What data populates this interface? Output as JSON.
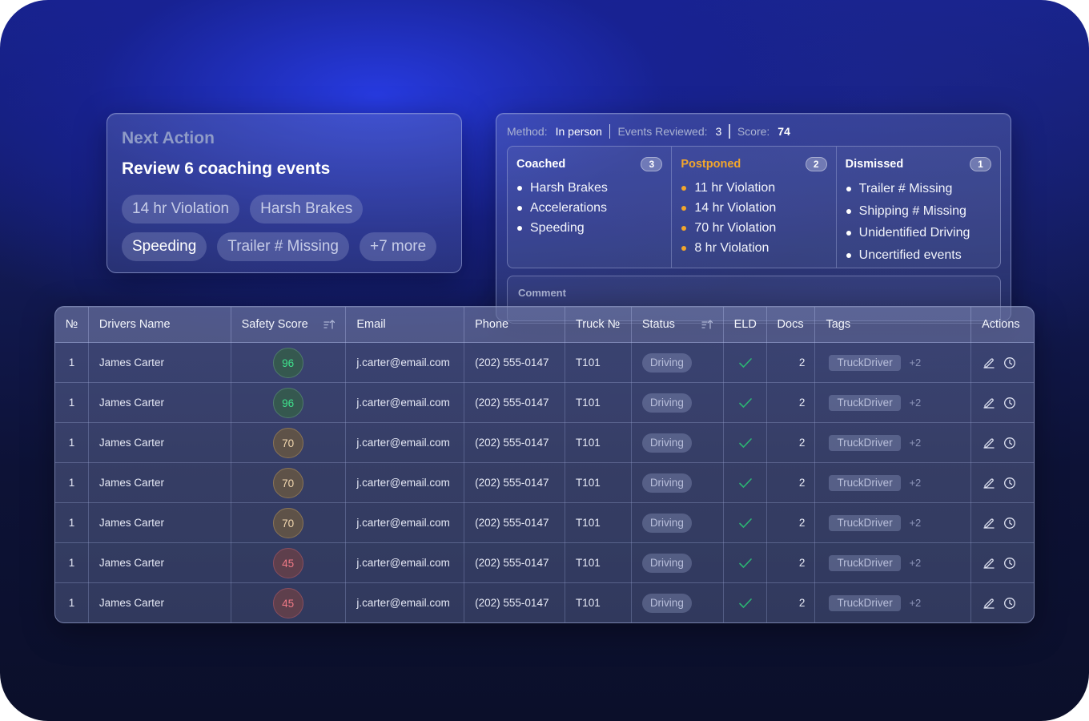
{
  "next_action": {
    "title": "Next Action",
    "subtitle": "Review 6 coaching events",
    "chips": [
      "14 hr Violation",
      "Harsh Brakes",
      "Speeding",
      "Trailer # Missing",
      "+7 more"
    ]
  },
  "review": {
    "method_label": "Method:",
    "method_value": "In person",
    "events_label": "Events Reviewed:",
    "events_value": "3",
    "score_label": "Score:",
    "score_value": "74",
    "columns": [
      {
        "title": "Coached",
        "count": "3",
        "items": [
          "Harsh Brakes",
          "Accelerations",
          "Speeding"
        ]
      },
      {
        "title": "Postponed",
        "count": "2",
        "items": [
          "11 hr Violation",
          "14 hr Violation",
          "70 hr Violation",
          "8 hr Violation"
        ]
      },
      {
        "title": "Dismissed",
        "count": "1",
        "items": [
          "Trailer # Missing",
          "Shipping # Missing",
          "Unidentified Driving",
          "Uncertified events"
        ]
      }
    ],
    "comment_label": "Comment"
  },
  "table": {
    "headers": [
      "№",
      "Drivers Name",
      "Safety Score",
      "Email",
      "Phone",
      "Truck №",
      "Status",
      "ELD",
      "Docs",
      "Tags",
      "Actions"
    ],
    "rows": [
      {
        "no": "1",
        "name": "James Carter",
        "score": "96",
        "email": "j.carter@email.com",
        "phone": "(202) 555-0147",
        "truck": "T101",
        "status": "Driving",
        "docs": "2",
        "tag": "TruckDriver",
        "tag_more": "+2"
      },
      {
        "no": "1",
        "name": "James Carter",
        "score": "96",
        "email": "j.carter@email.com",
        "phone": "(202) 555-0147",
        "truck": "T101",
        "status": "Driving",
        "docs": "2",
        "tag": "TruckDriver",
        "tag_more": "+2"
      },
      {
        "no": "1",
        "name": "James Carter",
        "score": "70",
        "email": "j.carter@email.com",
        "phone": "(202) 555-0147",
        "truck": "T101",
        "status": "Driving",
        "docs": "2",
        "tag": "TruckDriver",
        "tag_more": "+2"
      },
      {
        "no": "1",
        "name": "James Carter",
        "score": "70",
        "email": "j.carter@email.com",
        "phone": "(202) 555-0147",
        "truck": "T101",
        "status": "Driving",
        "docs": "2",
        "tag": "TruckDriver",
        "tag_more": "+2"
      },
      {
        "no": "1",
        "name": "James Carter",
        "score": "70",
        "email": "j.carter@email.com",
        "phone": "(202) 555-0147",
        "truck": "T101",
        "status": "Driving",
        "docs": "2",
        "tag": "TruckDriver",
        "tag_more": "+2"
      },
      {
        "no": "1",
        "name": "James Carter",
        "score": "45",
        "email": "j.carter@email.com",
        "phone": "(202) 555-0147",
        "truck": "T101",
        "status": "Driving",
        "docs": "2",
        "tag": "TruckDriver",
        "tag_more": "+2"
      },
      {
        "no": "1",
        "name": "James Carter",
        "score": "45",
        "email": "j.carter@email.com",
        "phone": "(202) 555-0147",
        "truck": "T101",
        "status": "Driving",
        "docs": "2",
        "tag": "TruckDriver",
        "tag_more": "+2"
      }
    ]
  },
  "colors": {
    "accent_orange": "#f2a62c",
    "score_green": "#3fe08c",
    "score_amber": "#f4d9b0",
    "score_red": "#f07a86",
    "eld_check": "#2bb673"
  },
  "icons": {
    "sort": "sort-icon",
    "eld": "check-icon",
    "edit": "edit-icon",
    "history": "clock-icon"
  }
}
